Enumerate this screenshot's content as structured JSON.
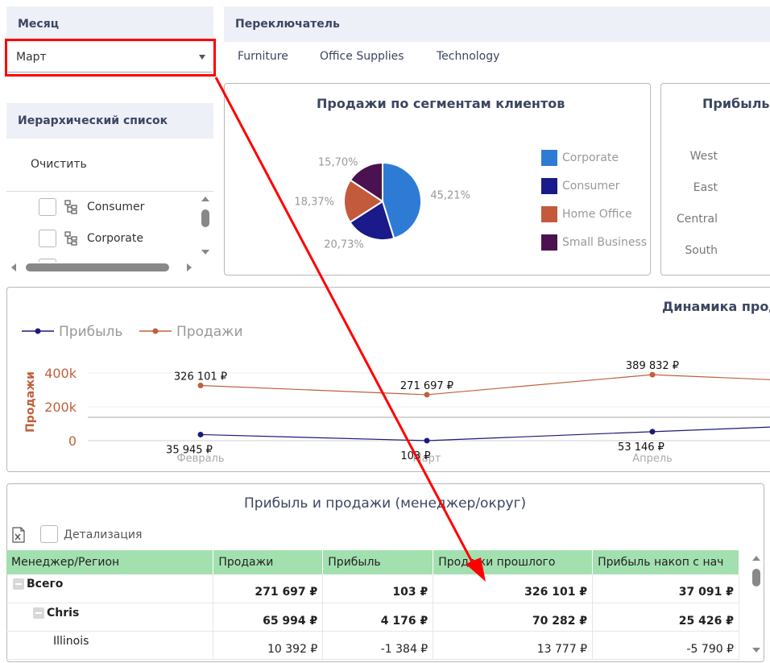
{
  "filters": {
    "month_title": "Месяц",
    "month_value": "Март",
    "switch_title": "Переключатель",
    "tabs": [
      "Furniture",
      "Office Supplies",
      "Technology"
    ]
  },
  "hierarchy": {
    "title": "Иерархический список",
    "clear_label": "Очистить",
    "items": [
      "Consumer",
      "Corporate"
    ]
  },
  "pie_card": {
    "title": "Продажи по сегментам клиентов",
    "chart_data": {
      "type": "pie",
      "slices": [
        {
          "label": "Corporate",
          "value": 45.21,
          "display": "45,21%",
          "color": "#2e7bd6"
        },
        {
          "label": "Consumer",
          "value": 20.73,
          "display": "20,73%",
          "color": "#1a1a8a"
        },
        {
          "label": "Home Office",
          "value": 18.37,
          "display": "18,37%",
          "color": "#c45a3c"
        },
        {
          "label": "Small Business",
          "value": 15.7,
          "display": "15,70%",
          "color": "#4a1250"
        }
      ],
      "legend_position": "right"
    }
  },
  "bar_card": {
    "title": "Прибыль",
    "chart_data": {
      "type": "bar",
      "categories": [
        "West",
        "East",
        "Central",
        "South"
      ]
    }
  },
  "line_card": {
    "title": "Динамика продаж",
    "chart_data": {
      "type": "line",
      "categories": [
        "Февраль",
        "Март",
        "Апрель"
      ],
      "ylabel": "Продажи",
      "yticks": [
        "400k",
        "200k",
        "0"
      ],
      "ylim": [
        0,
        400000
      ],
      "series": [
        {
          "name": "Прибыль",
          "color": "#1a1a7a",
          "values": [
            35945,
            103,
            53146,
            90000
          ],
          "labels": [
            "35 945 ₽",
            "103 ₽",
            "53 146 ₽"
          ]
        },
        {
          "name": "Продажи",
          "color": "#c0603c",
          "values": [
            326101,
            271697,
            389832,
            350000
          ],
          "labels": [
            "326 101 ₽",
            "271 697 ₽",
            "389 832 ₽"
          ]
        }
      ]
    }
  },
  "table_card": {
    "title": "Прибыль и продажи (менеджер/округ)",
    "detail_label": "Детализация",
    "columns": [
      "Менеджер/Регион",
      "Продажи",
      "Прибыль",
      "Продажи прошлого",
      "Прибыль накоп с нач"
    ],
    "rows": [
      {
        "name": "Всего",
        "level": 0,
        "bold": true,
        "values": [
          "271 697 ₽",
          "103 ₽",
          "326 101 ₽",
          "37 091 ₽"
        ]
      },
      {
        "name": "Chris",
        "level": 1,
        "bold": true,
        "values": [
          "65 994 ₽",
          "4 176 ₽",
          "70 282 ₽",
          "25 426 ₽"
        ]
      },
      {
        "name": "Illinois",
        "level": 2,
        "bold": false,
        "values": [
          "10 392 ₽",
          "-1 384 ₽",
          "13 777 ₽",
          "-5 790 ₽"
        ]
      }
    ]
  },
  "colors": {
    "accent_red": "#ff0000",
    "header_bg": "#eef0f8",
    "table_header": "#a3e0b0"
  }
}
